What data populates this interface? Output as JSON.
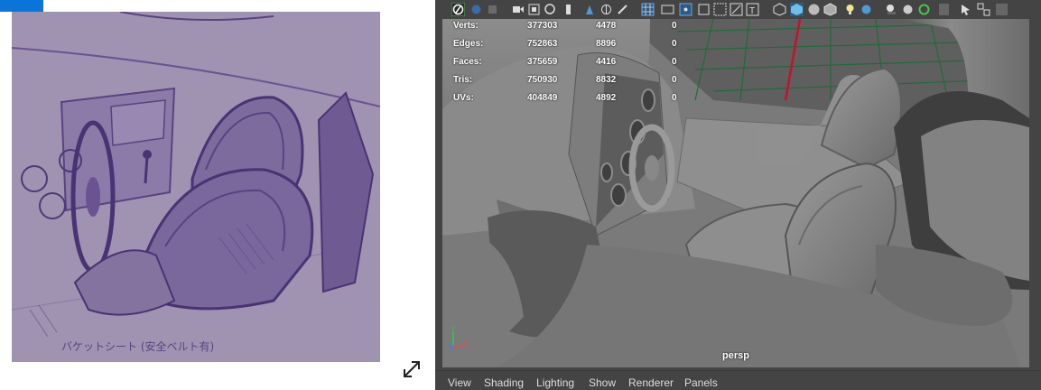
{
  "reference_panel": {
    "caption": "バケットシート (安全ベルト有)"
  },
  "viewport": {
    "hud": {
      "rows": [
        {
          "label": "Verts:",
          "v1": "377303",
          "v2": "4478",
          "v3": "0"
        },
        {
          "label": "Edges:",
          "v1": "752863",
          "v2": "8896",
          "v3": "0"
        },
        {
          "label": "Faces:",
          "v1": "375659",
          "v2": "4416",
          "v3": "0"
        },
        {
          "label": "Tris:",
          "v1": "750930",
          "v2": "8832",
          "v3": "0"
        },
        {
          "label": "UVs:",
          "v1": "404849",
          "v2": "4892",
          "v3": "0"
        }
      ]
    },
    "camera_label": "persp"
  },
  "menubar": {
    "items": [
      "View",
      "Shading",
      "Lighting",
      "Show",
      "Renderer",
      "Panels"
    ]
  },
  "colors": {
    "accent_blue": "#0a74d8",
    "ui_dark": "#444444",
    "grid_green": "#1f6b3a",
    "axis_red": "#c8102e"
  },
  "icons": [
    "expand-arrow-icon",
    "select-camera-icon",
    "wireframe-icon",
    "smooth-shade-icon",
    "textured-icon",
    "lights-icon",
    "shadows-icon",
    "isolate-icon",
    "xray-icon",
    "grid-icon",
    "film-gate-icon",
    "resolution-gate-icon",
    "hud-icon"
  ]
}
